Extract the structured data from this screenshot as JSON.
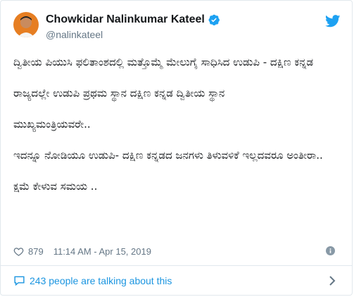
{
  "author": {
    "name": "Chowkidar Nalinkumar Kateel",
    "handle": "@nalinkateel",
    "verified_icon": "verified-badge-icon"
  },
  "tweet": {
    "paragraphs": [
      "ದ್ವಿತೀಯ ಪಿಯುಸಿ ಫಲಿತಾಂಶದಲ್ಲಿ ಮತ್ತೊಮ್ಮೆ ಮೇಲುಗೈ ಸಾಧಿಸಿದ ಉಡುಪಿ - ದಕ್ಷಿಣ ಕನ್ನಡ",
      "ರಾಜ್ಯದಲ್ಲೇ ಉಡುಪಿ ಪ್ರಥಮ ಸ್ಥಾನ ದಕ್ಷಿಣ ಕನ್ನಡ ದ್ವಿತೀಯ ಸ್ಥಾನ",
      "ಮುಖ್ಯಮಂತ್ರಿಯವರೇ..",
      "ಇದನ್ನೂ ನೋಡಿಯೂ ಉಡುಪಿ- ದಕ್ಷಿಣ ಕನ್ನಡದ ಜನಗಳು ತಿಳುವಳಿಕೆ ಇಲ್ಲದವರೂ ಅಂತೀರಾ..",
      "ಕ್ಷಮೆ ಕೇಳುವ ಸಮಯ .."
    ]
  },
  "meta": {
    "likes": "879",
    "timestamp": "11:14 AM - Apr 15, 2019"
  },
  "footer": {
    "talking": "243 people are talking about this"
  },
  "colors": {
    "accent": "#1b95e0",
    "muted": "#657786",
    "verified": "#1da1f2"
  }
}
